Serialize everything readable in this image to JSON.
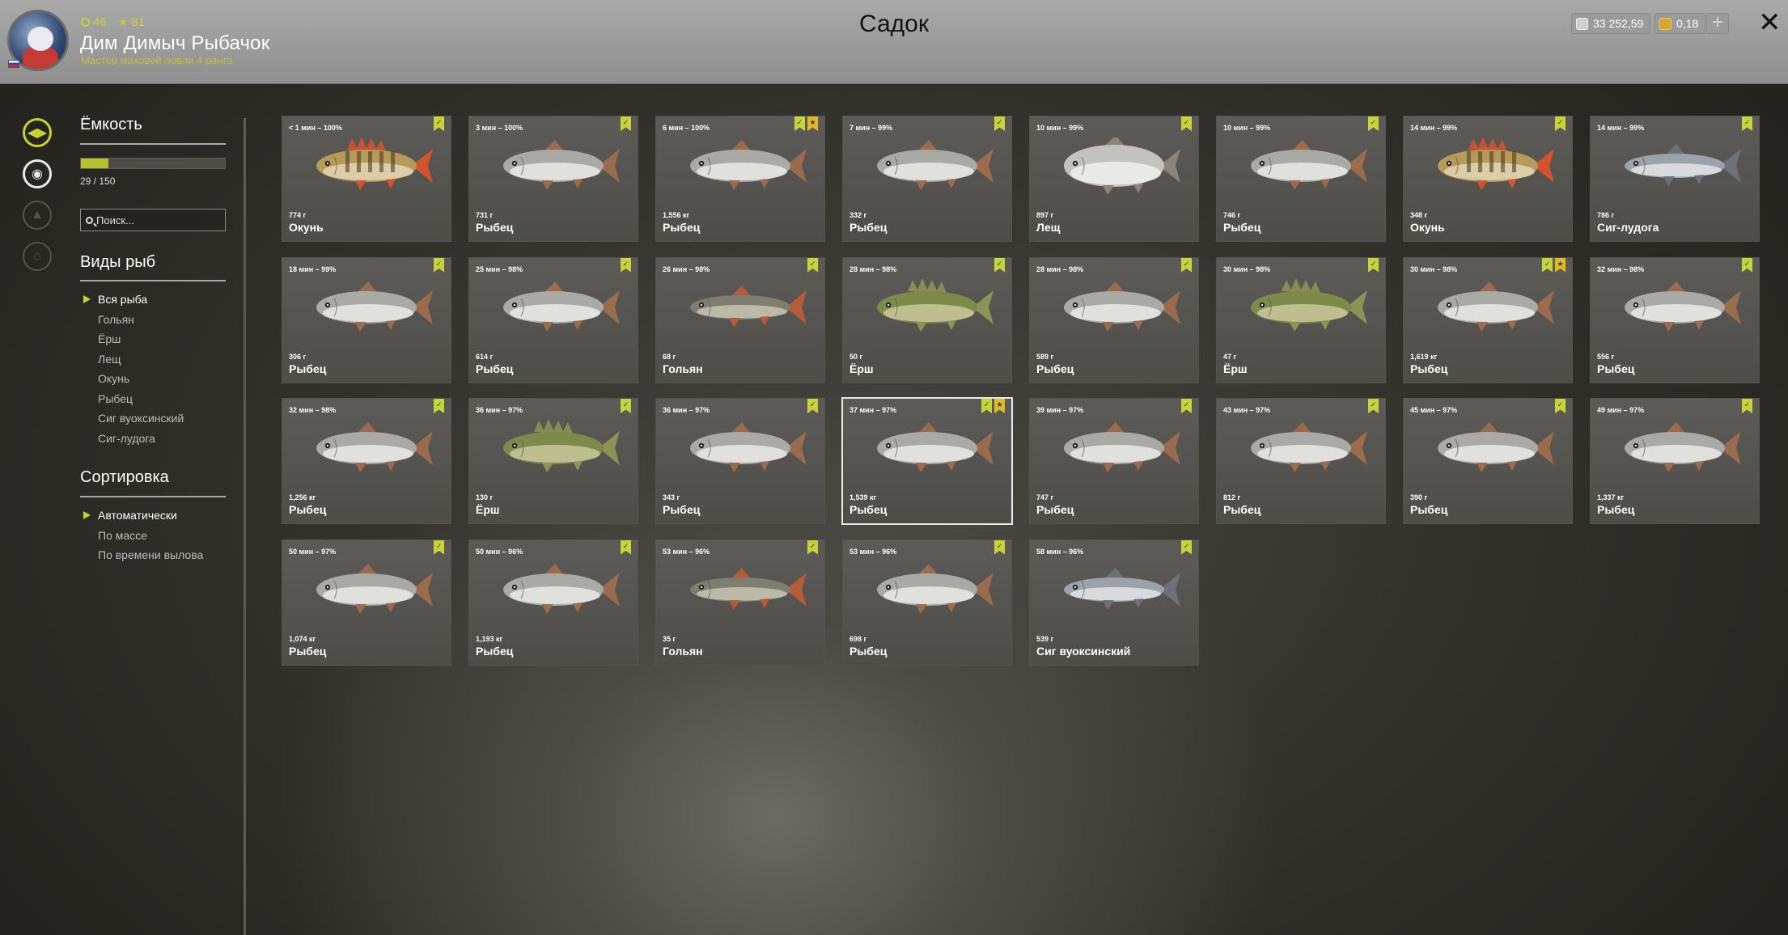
{
  "header": {
    "title": "Садок",
    "level": "46",
    "stars": "81",
    "player_name": "Дим Димыч Рыбачок",
    "player_rank": "Мастер маховой ловли 4 ранга",
    "silver": "33 252,59",
    "gold": "0,18",
    "plus": "+",
    "close": "✕"
  },
  "sidebar": {
    "capacity_title": "Ёмкость",
    "capacity_text": "29 / 150",
    "capacity_fraction": 0.1933,
    "search_placeholder": "Поиск...",
    "species_title": "Виды рыб",
    "species": [
      "Вся рыба",
      "Гольян",
      "Ёрш",
      "Лещ",
      "Окунь",
      "Рыбец",
      "Сиг вуоксинский",
      "Сиг-лудога"
    ],
    "species_selected": 0,
    "sort_title": "Сортировка",
    "sort_options": [
      "Автоматически",
      "По массе",
      "По времени вылова"
    ],
    "sort_selected": 0
  },
  "colors": {
    "accent": "#c7d331",
    "bookmark": "#c6d33a",
    "trophy_star": "#e0b82a"
  },
  "fish": [
    {
      "time": "< 1 мин – 100%",
      "weight": "774 г",
      "name": "Окунь",
      "kind": "perch",
      "star": false
    },
    {
      "time": "3 мин – 100%",
      "weight": "731 г",
      "name": "Рыбец",
      "kind": "silver",
      "star": false
    },
    {
      "time": "6 мин – 100%",
      "weight": "1,556 кг",
      "name": "Рыбец",
      "kind": "silver",
      "star": true
    },
    {
      "time": "7 мин – 99%",
      "weight": "332 г",
      "name": "Рыбец",
      "kind": "silver",
      "star": false
    },
    {
      "time": "10 мин – 99%",
      "weight": "897 г",
      "name": "Лещ",
      "kind": "bream",
      "star": false
    },
    {
      "time": "10 мин – 99%",
      "weight": "746 г",
      "name": "Рыбец",
      "kind": "silver",
      "star": false
    },
    {
      "time": "14 мин – 99%",
      "weight": "348 г",
      "name": "Окунь",
      "kind": "perch",
      "star": false
    },
    {
      "time": "14 мин – 99%",
      "weight": "786 г",
      "name": "Сиг-лудога",
      "kind": "whitefish",
      "star": false
    },
    {
      "time": "18 мин – 99%",
      "weight": "306 г",
      "name": "Рыбец",
      "kind": "silver",
      "star": false
    },
    {
      "time": "25 мин – 98%",
      "weight": "614 г",
      "name": "Рыбец",
      "kind": "silver",
      "star": false
    },
    {
      "time": "26 мин – 98%",
      "weight": "68 г",
      "name": "Гольян",
      "kind": "minnow",
      "star": false
    },
    {
      "time": "28 мин – 98%",
      "weight": "50 г",
      "name": "Ёрш",
      "kind": "ruffe",
      "star": false
    },
    {
      "time": "28 мин – 98%",
      "weight": "589 г",
      "name": "Рыбец",
      "kind": "silver",
      "star": false
    },
    {
      "time": "30 мин – 98%",
      "weight": "47 г",
      "name": "Ёрш",
      "kind": "ruffe",
      "star": false
    },
    {
      "time": "30 мин – 98%",
      "weight": "1,619 кг",
      "name": "Рыбец",
      "kind": "silver",
      "star": true
    },
    {
      "time": "32 мин – 98%",
      "weight": "556 г",
      "name": "Рыбец",
      "kind": "silver",
      "star": false
    },
    {
      "time": "32 мин – 98%",
      "weight": "1,256 кг",
      "name": "Рыбец",
      "kind": "silver",
      "star": false
    },
    {
      "time": "36 мин – 97%",
      "weight": "130 г",
      "name": "Ёрш",
      "kind": "ruffe",
      "star": false
    },
    {
      "time": "36 мин – 97%",
      "weight": "343 г",
      "name": "Рыбец",
      "kind": "silver",
      "star": false
    },
    {
      "time": "37 мин – 97%",
      "weight": "1,539 кг",
      "name": "Рыбец",
      "kind": "silver",
      "star": true,
      "highlighted": true
    },
    {
      "time": "39 мин – 97%",
      "weight": "747 г",
      "name": "Рыбец",
      "kind": "silver",
      "star": false
    },
    {
      "time": "43 мин – 97%",
      "weight": "812 г",
      "name": "Рыбец",
      "kind": "silver",
      "star": false
    },
    {
      "time": "45 мин – 97%",
      "weight": "390 г",
      "name": "Рыбец",
      "kind": "silver",
      "star": false
    },
    {
      "time": "49 мин – 97%",
      "weight": "1,337 кг",
      "name": "Рыбец",
      "kind": "silver",
      "star": false
    },
    {
      "time": "50 мин – 97%",
      "weight": "1,074 кг",
      "name": "Рыбец",
      "kind": "silver",
      "star": false
    },
    {
      "time": "50 мин – 96%",
      "weight": "1,193 кг",
      "name": "Рыбец",
      "kind": "silver",
      "star": false
    },
    {
      "time": "53 мин – 96%",
      "weight": "35 г",
      "name": "Гольян",
      "kind": "minnow",
      "star": false
    },
    {
      "time": "53 мин – 96%",
      "weight": "698 г",
      "name": "Рыбец",
      "kind": "silver",
      "star": false
    },
    {
      "time": "58 мин – 96%",
      "weight": "539 г",
      "name": "Сиг вуоксинский",
      "kind": "whitefish",
      "star": false
    }
  ]
}
